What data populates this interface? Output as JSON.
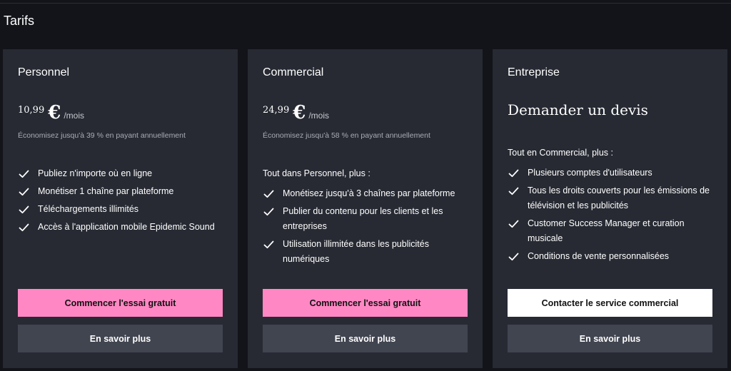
{
  "page": {
    "title": "Tarifs"
  },
  "plans": [
    {
      "name": "Personnel",
      "price": "10,99",
      "currency": "€",
      "period": "/mois",
      "savings": "Économisez jusqu'à 39 % en payant annuellement",
      "features": [
        "Publiez n'importe où en ligne",
        "Monétiser 1 chaîne par plateforme",
        "Téléchargements illimités",
        "Accès à l'application mobile Epidemic Sound"
      ],
      "primary_button": "Commencer l'essai gratuit",
      "secondary_button": "En savoir plus"
    },
    {
      "name": "Commercial",
      "price": "24,99",
      "currency": "€",
      "period": "/mois",
      "savings": "Économisez jusqu'à 58 % en payant annuellement",
      "intro": "Tout dans Personnel, plus :",
      "features": [
        "Monétisez jusqu'à 3 chaînes par plateforme",
        "Publier du contenu pour les clients et les entreprises",
        "Utilisation illimitée dans les publicités numériques"
      ],
      "primary_button": "Commencer l'essai gratuit",
      "secondary_button": "En savoir plus"
    },
    {
      "name": "Entreprise",
      "quote": "Demander un devis",
      "intro": "Tout en Commercial, plus :",
      "features": [
        "Plusieurs comptes d'utilisateurs",
        "Tous les droits couverts pour les émissions de télévision et les publicités",
        "Customer Success Manager et curation musicale",
        "Conditions de vente personnalisées"
      ],
      "primary_button": "Contacter le service commercial",
      "secondary_button": "En savoir plus"
    }
  ],
  "icons": {
    "feature_check": "checkmark-icon"
  },
  "colors": {
    "background": "#121419",
    "card": "#272a33",
    "accent_pink": "#ff88c4",
    "secondary_button": "#414550",
    "white_button": "#ffffff"
  }
}
